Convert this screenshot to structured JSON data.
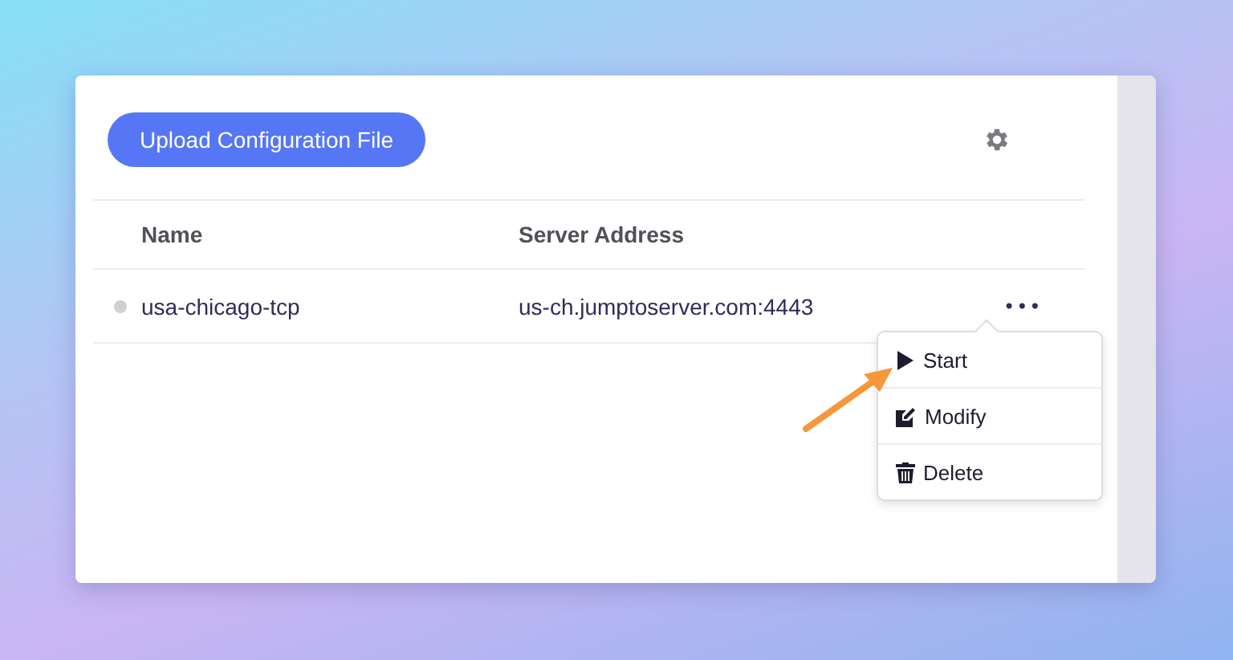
{
  "toolbar": {
    "upload_button": "Upload Configuration File"
  },
  "table": {
    "columns": [
      "Name",
      "Server Address"
    ],
    "rows": [
      {
        "color": "#cfcfd4",
        "name": "usa-chicago-tcp",
        "server_address": "us-ch.jumptoserver.com:4443",
        "actions": "•••"
      }
    ]
  },
  "context_menu": {
    "items": [
      {
        "kind": "start",
        "label": "Start"
      },
      {
        "kind": "modify",
        "label": "Modify"
      },
      {
        "kind": "delete",
        "label": "Delete"
      }
    ]
  }
}
